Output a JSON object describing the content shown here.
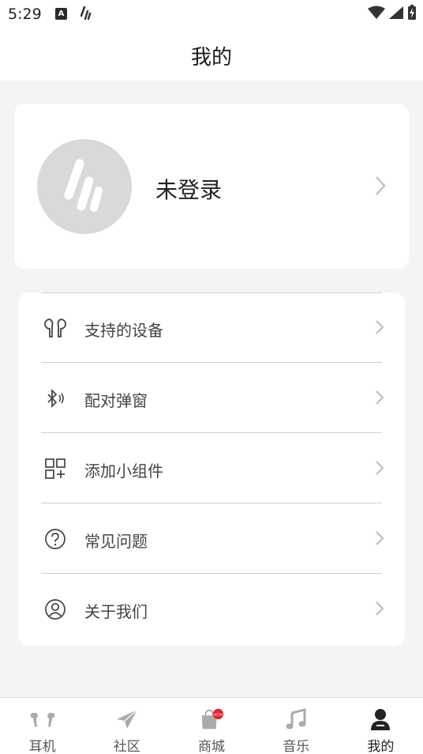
{
  "status": {
    "time": "5:29",
    "a_badge": "A"
  },
  "header": {
    "title": "我的"
  },
  "profile": {
    "login_label": "未登录"
  },
  "menu": {
    "items": [
      {
        "label": "支持的设备",
        "icon": "earbuds-icon"
      },
      {
        "label": "配对弹窗",
        "icon": "bluetooth-icon"
      },
      {
        "label": "添加小组件",
        "icon": "widget-add-icon"
      },
      {
        "label": "常见问题",
        "icon": "question-icon"
      },
      {
        "label": "关于我们",
        "icon": "user-circle-icon"
      }
    ]
  },
  "tabbar": {
    "tabs": [
      {
        "label": "耳机",
        "icon": "earphones-icon"
      },
      {
        "label": "社区",
        "icon": "paper-plane-icon"
      },
      {
        "label": "商城",
        "icon": "shopping-bag-icon",
        "badge": "new"
      },
      {
        "label": "音乐",
        "icon": "music-note-icon"
      },
      {
        "label": "我的",
        "icon": "person-icon",
        "active": true
      }
    ]
  },
  "colors": {
    "background": "#f3f4f6",
    "card": "#ffffff",
    "badge": "#e8202a",
    "inactive_icon": "#aaaaaa",
    "active_icon": "#222222"
  }
}
